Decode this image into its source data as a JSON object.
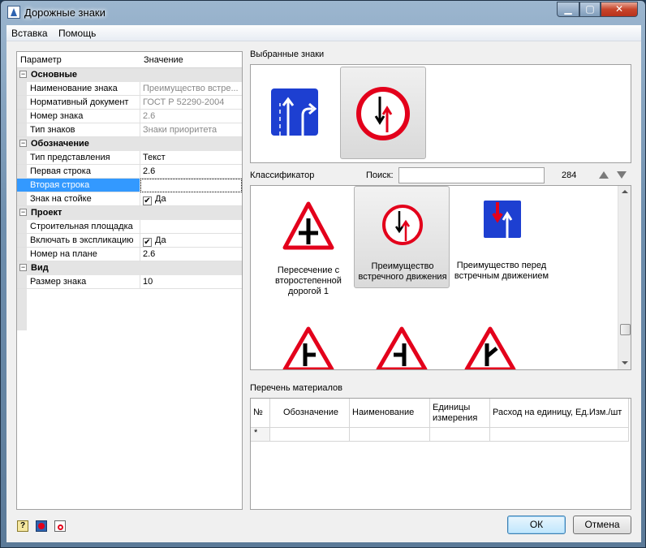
{
  "window": {
    "title": "Дорожные знаки",
    "minimize": "▁",
    "maximize": "▢",
    "close": "✕"
  },
  "menu": {
    "insert": "Вставка",
    "help": "Помощь"
  },
  "grid": {
    "header_param": "Параметр",
    "header_value": "Значение",
    "cat_basic": "Основные",
    "sign_name_label": "Наименование знака",
    "sign_name_value": "Преимущество встре...",
    "norm_doc_label": "Нормативный документ",
    "norm_doc_value": "ГОСТ Р 52290-2004",
    "sign_number_label": "Номер знака",
    "sign_number_value": "2.6",
    "sign_type_label": "Тип знаков",
    "sign_type_value": "Знаки приоритета",
    "cat_designation": "Обозначение",
    "repr_type_label": "Тип представления",
    "repr_type_value": "Текст",
    "first_line_label": "Первая строка",
    "first_line_value": "2.6",
    "second_line_label": "Вторая строка",
    "second_line_value": "",
    "on_post_label": "Знак на стойке",
    "on_post_value": "Да",
    "cat_project": "Проект",
    "site_label": "Строительная площадка",
    "site_value": "",
    "include_label": "Включать в экспликацию",
    "include_value": "Да",
    "plan_number_label": "Номер на плане",
    "plan_number_value": "2.6",
    "cat_view": "Вид",
    "size_label": "Размер знака",
    "size_value": "10"
  },
  "selected": {
    "label": "Выбранные знаки"
  },
  "classifier": {
    "label": "Классификатор",
    "search_label": "Поиск:",
    "search_value": "",
    "count": "284",
    "items": [
      {
        "caption": "Пересечение с второстепенной дорогой 1"
      },
      {
        "caption": "Преимущество встречного движения"
      },
      {
        "caption": "Преимущество перед встречным движением"
      }
    ]
  },
  "materials": {
    "label": "Перечень материалов",
    "col_no": "№",
    "col_code": "Обозначение",
    "col_name": "Наименование",
    "col_units": "Единицы измерения",
    "col_rate": "Расход на единицу, Ед.Изм./шт",
    "new_row_marker": "*"
  },
  "buttons": {
    "ok": "ОК",
    "cancel": "Отмена"
  },
  "colors": {
    "accent": "#3399ff",
    "sign_red": "#e3001b",
    "sign_blue": "#1d3fd1"
  },
  "icons": [
    "help-icon",
    "sign-settings-icon",
    "gost-icon"
  ]
}
